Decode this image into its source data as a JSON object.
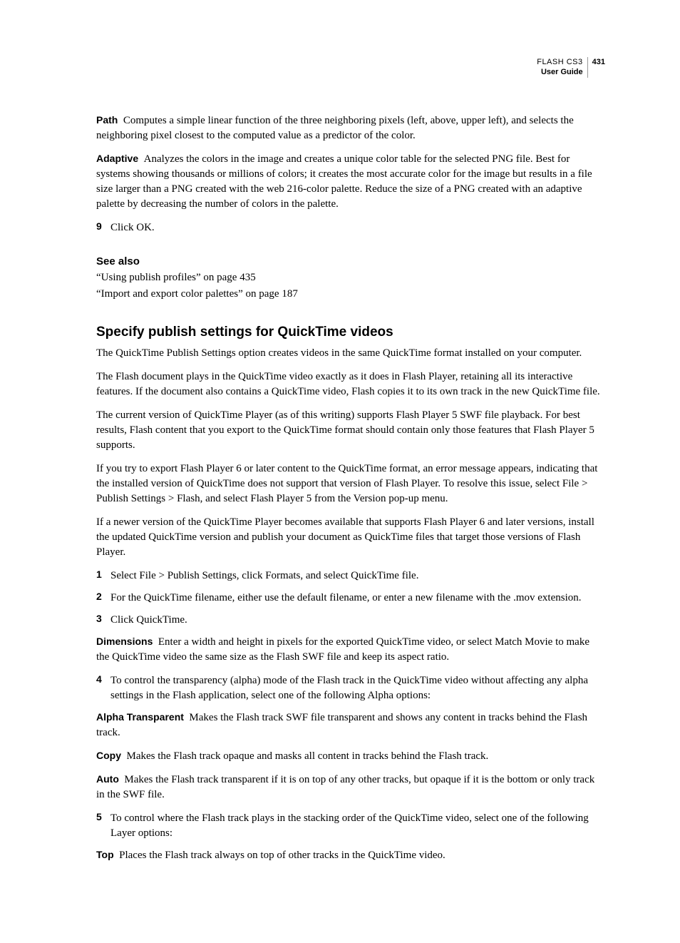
{
  "header": {
    "product": "FLASH CS3",
    "guide": "User Guide",
    "page_number": "431"
  },
  "defs": {
    "path": {
      "term": "Path",
      "text": "Computes a simple linear function of the three neighboring pixels (left, above, upper left), and selects the neighboring pixel closest to the computed value as a predictor of the color."
    },
    "adaptive": {
      "term": "Adaptive",
      "text": "Analyzes the colors in the image and creates a unique color table for the selected PNG file. Best for systems showing thousands or millions of colors; it creates the most accurate color for the image but results in a file size larger than a PNG created with the web 216-color palette. Reduce the size of a PNG created with an adaptive palette by decreasing the number of colors in the palette."
    }
  },
  "step9": {
    "num": "9",
    "text": "Click OK."
  },
  "see_also": {
    "heading": "See also",
    "ref1": "“Using publish profiles” on page 435",
    "ref2": "“Import and export color palettes” on page 187"
  },
  "section": {
    "heading": "Specify publish settings for QuickTime videos",
    "p1": "The QuickTime Publish Settings option creates videos in the same QuickTime format installed on your computer.",
    "p2": "The Flash document plays in the QuickTime video exactly as it does in Flash Player, retaining all its interactive features. If the document also contains a QuickTime video, Flash copies it to its own track in the new QuickTime file.",
    "p3": "The current version of QuickTime Player (as of this writing) supports Flash Player 5 SWF file playback. For best results, Flash content that you export to the QuickTime format should contain only those features that Flash Player 5 supports.",
    "p4": "If you try to export Flash Player 6 or later content to the QuickTime format, an error message appears, indicating that the installed version of QuickTime does not support that version of Flash Player. To resolve this issue, select File > Publish Settings > Flash, and select Flash Player 5 from the Version pop-up menu.",
    "p5": "If a newer version of the QuickTime Player becomes available that supports Flash Player 6 and later versions, install the updated QuickTime version and publish your document as QuickTime files that target those versions of Flash Player.",
    "steps": {
      "s1": {
        "num": "1",
        "text": "Select File > Publish Settings, click Formats, and select QuickTime file."
      },
      "s2": {
        "num": "2",
        "text": "For the QuickTime filename, either use the default filename, or enter a new filename with the .mov extension."
      },
      "s3": {
        "num": "3",
        "text": "Click QuickTime."
      }
    },
    "dimensions": {
      "term": "Dimensions",
      "text": "Enter a width and height in pixels for the exported QuickTime video, or select Match Movie to make the QuickTime video the same size as the Flash SWF file and keep its aspect ratio."
    },
    "step4": {
      "num": "4",
      "text": "To control the transparency (alpha) mode of the Flash track in the QuickTime video without affecting any alpha settings in the Flash application, select one of the following Alpha options:"
    },
    "alpha_transparent": {
      "term": "Alpha Transparent",
      "text": "Makes the Flash track SWF file transparent and shows any content in tracks behind the Flash track."
    },
    "copy": {
      "term": "Copy",
      "text": "Makes the Flash track opaque and masks all content in tracks behind the Flash track."
    },
    "auto": {
      "term": "Auto",
      "text": "Makes the Flash track transparent if it is on top of any other tracks, but opaque if it is the bottom or only track in the SWF file."
    },
    "step5": {
      "num": "5",
      "text": "To control where the Flash track plays in the stacking order of the QuickTime video, select one of the following Layer options:"
    },
    "top": {
      "term": "Top",
      "text": "Places the Flash track always on top of other tracks in the QuickTime video."
    }
  }
}
